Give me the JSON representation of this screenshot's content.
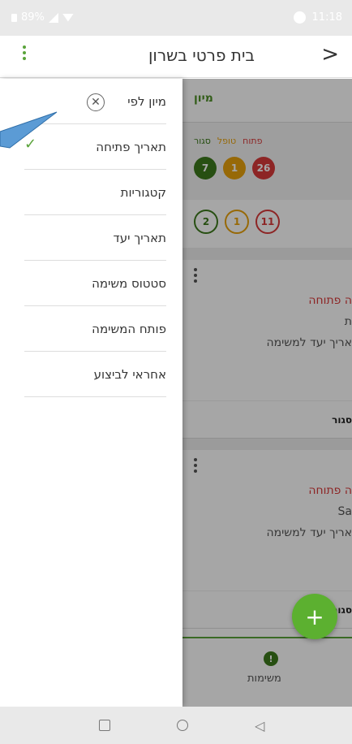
{
  "status_bar": {
    "battery": "89%",
    "time": "11:18"
  },
  "app_bar": {
    "title": "בית פרטי בשרון",
    "back_glyph": ">"
  },
  "drawer": {
    "header": "מיון לפי",
    "items": [
      {
        "label": "תאריך פתיחה",
        "selected": true
      },
      {
        "label": "קטגוריות",
        "selected": false
      },
      {
        "label": "תאריך יעד",
        "selected": false
      },
      {
        "label": "סטטוס משימה",
        "selected": false
      },
      {
        "label": "פותח המשימה",
        "selected": false
      },
      {
        "label": "אחראי לביצוע",
        "selected": false
      }
    ]
  },
  "background": {
    "tab_label": "מיון",
    "stat_labels": {
      "closed": "סגור",
      "handled": "טופל",
      "open": "פתוח"
    },
    "stat_counts": {
      "closed": "7",
      "handled": "1",
      "open": "26"
    },
    "ring_counts": {
      "green": "2",
      "orange": "1",
      "red": "11"
    },
    "cards": [
      {
        "status": "ה פתוחה",
        "line2": "ת",
        "line3": "אריך יעד למשימה",
        "footer": "סגור"
      },
      {
        "status": "ה פתוחה",
        "line2": "Sa",
        "line3": "אריך יעד למשימה",
        "footer": "סגור"
      }
    ],
    "bottom_nav_label": "משימות",
    "bottom_nav_badge": "!"
  },
  "fab_label": "+",
  "colors": {
    "accent": "#5aa33a",
    "closed": "#3d7a1c",
    "handled": "#e8a10c",
    "open": "#d93a3a"
  }
}
